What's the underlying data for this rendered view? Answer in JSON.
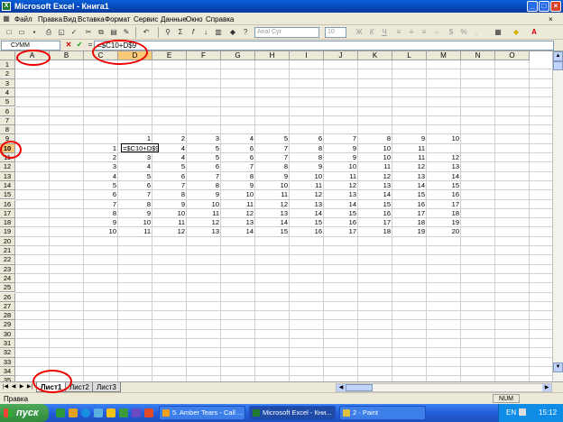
{
  "window": {
    "title": "Microsoft Excel - Книга1",
    "app_icon": "excel-icon"
  },
  "menu": [
    "Файл",
    "Правка",
    "Вид",
    "Вставка",
    "Формат",
    "Сервис",
    "Данные",
    "Окно",
    "Справка"
  ],
  "toolbar": {
    "font_name": "Arial Cyr",
    "font_size": "10"
  },
  "formula_bar": {
    "name_box": "СУММ",
    "formula": "=$C10+D$9",
    "fx_label": "="
  },
  "columns": [
    "A",
    "B",
    "C",
    "D",
    "E",
    "F",
    "G",
    "H",
    "I",
    "J",
    "K",
    "L",
    "M",
    "N",
    "O"
  ],
  "rows": [
    "1",
    "2",
    "3",
    "4",
    "5",
    "6",
    "7",
    "8",
    "9",
    "10",
    "11",
    "12",
    "13",
    "14",
    "15",
    "16",
    "17",
    "18",
    "19",
    "20",
    "21",
    "22",
    "23",
    "24",
    "25",
    "26",
    "27",
    "28",
    "29",
    "30",
    "31",
    "32",
    "33",
    "34",
    "35"
  ],
  "selected": {
    "column": "D",
    "row": "10"
  },
  "cells": {
    "row9": [
      "1",
      "2",
      "3",
      "4",
      "5",
      "6",
      "7",
      "8",
      "9",
      "10"
    ],
    "col_c": [
      "1",
      "2",
      "3",
      "4",
      "5",
      "6",
      "7",
      "8",
      "9",
      "10"
    ],
    "editing_cell": "=$C10+D$9",
    "row10": [
      "",
      "4",
      "5",
      "6",
      "7",
      "8",
      "9",
      "10",
      "11"
    ],
    "row11": [
      "3",
      "4",
      "5",
      "6",
      "7",
      "8",
      "9",
      "10",
      "11",
      "12"
    ],
    "row12": [
      "4",
      "5",
      "6",
      "7",
      "8",
      "9",
      "10",
      "11",
      "12",
      "13"
    ],
    "row13": [
      "5",
      "6",
      "7",
      "8",
      "9",
      "10",
      "11",
      "12",
      "13",
      "14"
    ],
    "row14": [
      "6",
      "7",
      "8",
      "9",
      "10",
      "11",
      "12",
      "13",
      "14",
      "15"
    ],
    "row15": [
      "7",
      "8",
      "9",
      "10",
      "11",
      "12",
      "13",
      "14",
      "15",
      "16"
    ],
    "row16": [
      "8",
      "9",
      "10",
      "11",
      "12",
      "13",
      "14",
      "15",
      "16",
      "17"
    ],
    "row17": [
      "9",
      "10",
      "11",
      "12",
      "13",
      "14",
      "15",
      "16",
      "17",
      "18"
    ],
    "row18": [
      "10",
      "11",
      "12",
      "13",
      "14",
      "15",
      "16",
      "17",
      "18",
      "19"
    ],
    "row19": [
      "11",
      "12",
      "13",
      "14",
      "15",
      "16",
      "17",
      "18",
      "19",
      "20"
    ]
  },
  "sheets": [
    "Лист1",
    "Лист2",
    "Лист3"
  ],
  "active_sheet": "Лист1",
  "status": {
    "left": "Правка",
    "right": "NUM"
  },
  "taskbar": {
    "start": "пуск",
    "tasks": [
      "5. Amber Tears - Call ...",
      "Microsoft Excel - Кни...",
      "2 - Paint"
    ],
    "active_task": 1,
    "lang": "EN",
    "clock": "15:12"
  }
}
